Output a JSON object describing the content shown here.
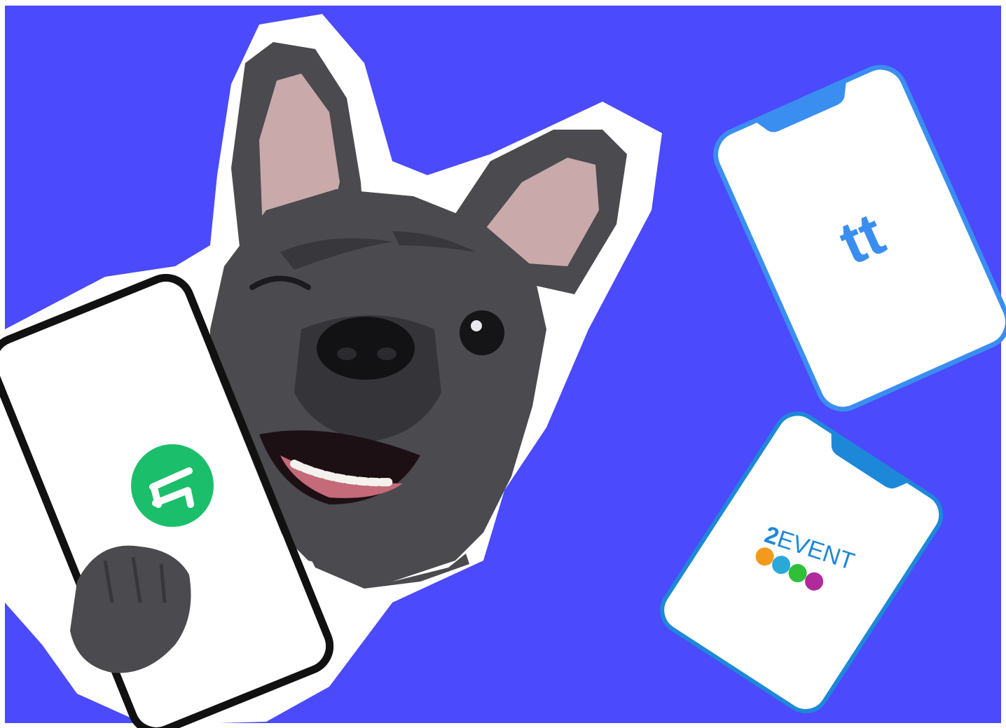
{
  "colors": {
    "background": "#4b4afc",
    "cutout": "#ffffff",
    "dog_fur": "#4a4a4f",
    "dog_fur_dark": "#2c2c31",
    "ear_inner": "#c9a9aa",
    "phone_left_frame": "#111111",
    "phone_right_frames": "#2f8fe8",
    "eventbrite_green": "#1bbf6b",
    "tt_blue": "#3a8ef0",
    "twoevent_blue": "#1e88d8",
    "twoevent_orange": "#f39a1e",
    "twoevent_teal": "#2aa8d8",
    "twoevent_green": "#2fbf3a",
    "twoevent_purple": "#b02a9c"
  },
  "phones": [
    {
      "id": "left",
      "app": "eventbrite",
      "icon": "eventbrite-e-logo"
    },
    {
      "id": "top-right",
      "app": "tt",
      "logo_text": "tt"
    },
    {
      "id": "bottom-right",
      "app": "2event",
      "logo_text_1": "2",
      "logo_text_2": "EVENT"
    }
  ]
}
